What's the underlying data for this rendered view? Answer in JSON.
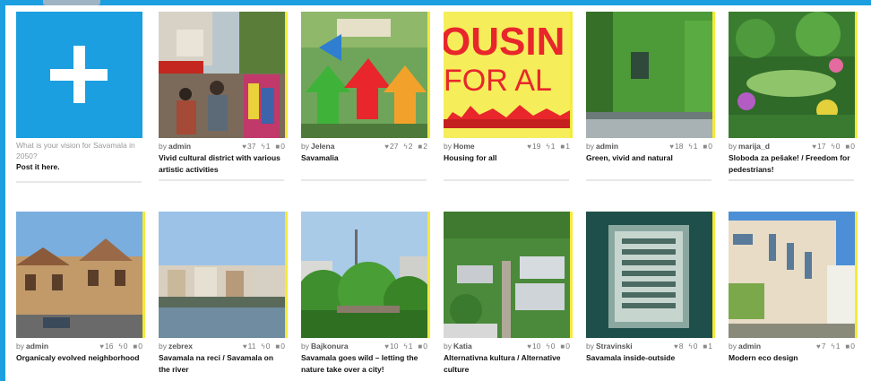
{
  "add_tile": {
    "prompt": "What is your vision for Savamala in 2050?",
    "link": "Post it here."
  },
  "by_label": "by",
  "cards": [
    {
      "author": "admin",
      "likes": "37",
      "shares": "1",
      "comments": "0",
      "title": "Vivid cultural district with various artistic activities",
      "image": "market-street"
    },
    {
      "author": "Jelena",
      "likes": "27",
      "shares": "2",
      "comments": "2",
      "title": "Savamalia",
      "image": "graffiti-arrows"
    },
    {
      "author": "Home",
      "likes": "19",
      "shares": "1",
      "comments": "1",
      "title": "Housing for all",
      "image": "housing-poster",
      "poster_line1": "OUSIN",
      "poster_line2": "FOR AL"
    },
    {
      "author": "admin",
      "likes": "18",
      "shares": "1",
      "comments": "0",
      "title": "Green, vivid and natural",
      "image": "green-facade"
    },
    {
      "author": "marija_d",
      "likes": "17",
      "shares": "0",
      "comments": "0",
      "title": "Sloboda za pešake! / Freedom for pedestrians!",
      "image": "garden"
    },
    {
      "author": "admin",
      "likes": "16",
      "shares": "0",
      "comments": "0",
      "title": "Organicaly evolved neighborhood",
      "image": "old-buildings"
    },
    {
      "author": "zebrex",
      "likes": "11",
      "shares": "0",
      "comments": "0",
      "title": "Savamala na reci / Savamala on the river",
      "image": "riverside"
    },
    {
      "author": "Bajkonura",
      "likes": "10",
      "shares": "1",
      "comments": "0",
      "title": "Savamala goes wild – letting the nature take over a city!",
      "image": "wild-city"
    },
    {
      "author": "Katia",
      "likes": "10",
      "shares": "0",
      "comments": "0",
      "title": "Alternativna kultura / Alternative culture",
      "image": "aerial"
    },
    {
      "author": "Stravinski",
      "likes": "8",
      "shares": "0",
      "comments": "1",
      "title": "Savamala inside-outside",
      "image": "intercom"
    },
    {
      "author": "admin",
      "likes": "7",
      "shares": "1",
      "comments": "0",
      "title": "Modern eco design",
      "image": "modern-building"
    }
  ],
  "icons": {
    "like": "heart-icon",
    "share": "share-icon",
    "comment": "comment-icon",
    "add": "plus-icon"
  },
  "colors": {
    "accent": "#1b9fe0",
    "highlight": "#f4ea3a",
    "poster_red": "#e8262b"
  }
}
